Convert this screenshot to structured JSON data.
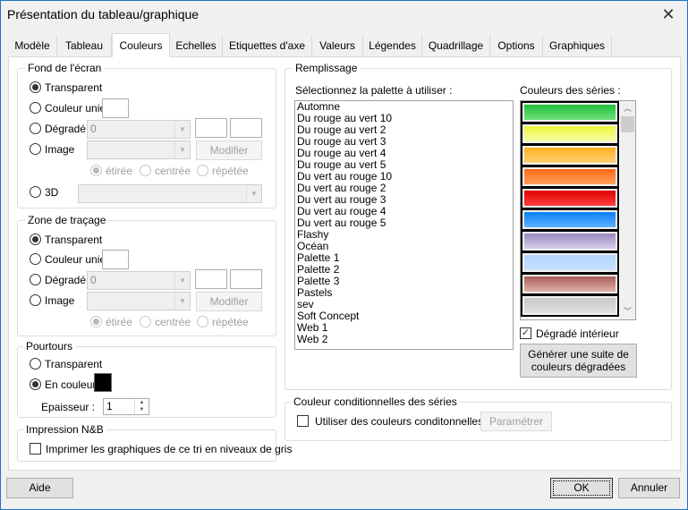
{
  "window": {
    "title": "Présentation du tableau/graphique",
    "close_icon": "close-icon"
  },
  "tabs": [
    {
      "label": "Modèle",
      "active": false
    },
    {
      "label": "Tableau",
      "active": false
    },
    {
      "label": "Couleurs",
      "active": true
    },
    {
      "label": "Echelles",
      "active": false
    },
    {
      "label": "Etiquettes d'axe",
      "active": false
    },
    {
      "label": "Valeurs",
      "active": false
    },
    {
      "label": "Légendes",
      "active": false
    },
    {
      "label": "Quadrillage",
      "active": false
    },
    {
      "label": "Options",
      "active": false
    },
    {
      "label": "Graphiques",
      "active": false
    }
  ],
  "fond_ecran": {
    "legend": "Fond de l'écran",
    "transparent": "Transparent",
    "couleur_unie": "Couleur unie",
    "degrade": "Dégradé",
    "degrade_value": "0",
    "image": "Image",
    "image_value": "",
    "modifier": "Modifier",
    "etiree": "étirée",
    "centree": "centrée",
    "repetee": "répétée",
    "three_d": "3D",
    "three_d_value": "",
    "selected": "Transparent",
    "image_mode_selected": "étirée"
  },
  "zone_tracage": {
    "legend": "Zone de traçage",
    "transparent": "Transparent",
    "couleur_unie": "Couleur unie",
    "degrade": "Dégradé",
    "degrade_value": "0",
    "image": "Image",
    "image_value": "",
    "modifier": "Modifier",
    "etiree": "étirée",
    "centree": "centrée",
    "repetee": "répétée",
    "selected": "Transparent",
    "image_mode_selected": "étirée"
  },
  "pourtours": {
    "legend": "Pourtours",
    "transparent": "Transparent",
    "en_couleur": "En couleur",
    "selected": "En couleur",
    "color": "#000000",
    "epaisseur_label": "Epaisseur :",
    "epaisseur_value": "1"
  },
  "impression": {
    "legend": "Impression N&B",
    "checkbox_label": "Imprimer les graphiques de ce tri en niveaux de gris",
    "checked": false
  },
  "remplissage": {
    "legend": "Remplissage",
    "palette_label": "Sélectionnez la palette à utiliser :",
    "palettes": [
      "Automne",
      "Du rouge au vert 10",
      "Du rouge au vert 2",
      "Du rouge au vert 3",
      "Du rouge au vert 4",
      "Du rouge au vert 5",
      "Du vert au rouge 10",
      "Du vert au rouge 2",
      "Du vert au rouge 3",
      "Du vert au rouge 4",
      "Du vert au rouge 5",
      "Flashy",
      "Océan",
      "Palette 1",
      "Palette 2",
      "Palette 3",
      "Pastels",
      "sev",
      "Soft Concept",
      "Web 1",
      "Web 2"
    ],
    "series_label": "Couleurs des séries :",
    "series_colors": [
      {
        "top": "#1fbf3a",
        "bottom": "#6fe07a"
      },
      {
        "top": "#eef53a",
        "bottom": "#f7fca8"
      },
      {
        "top": "#ffb020",
        "bottom": "#ffd070"
      },
      {
        "top": "#ff6a10",
        "bottom": "#ffa060"
      },
      {
        "top": "#e00000",
        "bottom": "#ff4040"
      },
      {
        "top": "#0a7ff5",
        "bottom": "#60b0ff"
      },
      {
        "top": "#9a88c0",
        "bottom": "#d8d0ea"
      },
      {
        "top": "#b0d4ff",
        "bottom": "#c8e2ff"
      },
      {
        "top": "#a86058",
        "bottom": "#e0b0a8"
      },
      {
        "top": "#c8c8c8",
        "bottom": "#e0e0e0"
      }
    ],
    "degrade_interieur_label": "Dégradé intérieur",
    "degrade_interieur_checked": true,
    "generer_button_line1": "Générer une suite de",
    "generer_button_line2": "couleurs dégradées"
  },
  "conditionnelles": {
    "legend": "Couleur conditionnelles des séries",
    "checkbox_label": "Utiliser des couleurs conditonnelles",
    "checked": false,
    "parametrer": "Paramétrer"
  },
  "footer": {
    "aide": "Aide",
    "ok": "OK",
    "annuler": "Annuler"
  }
}
